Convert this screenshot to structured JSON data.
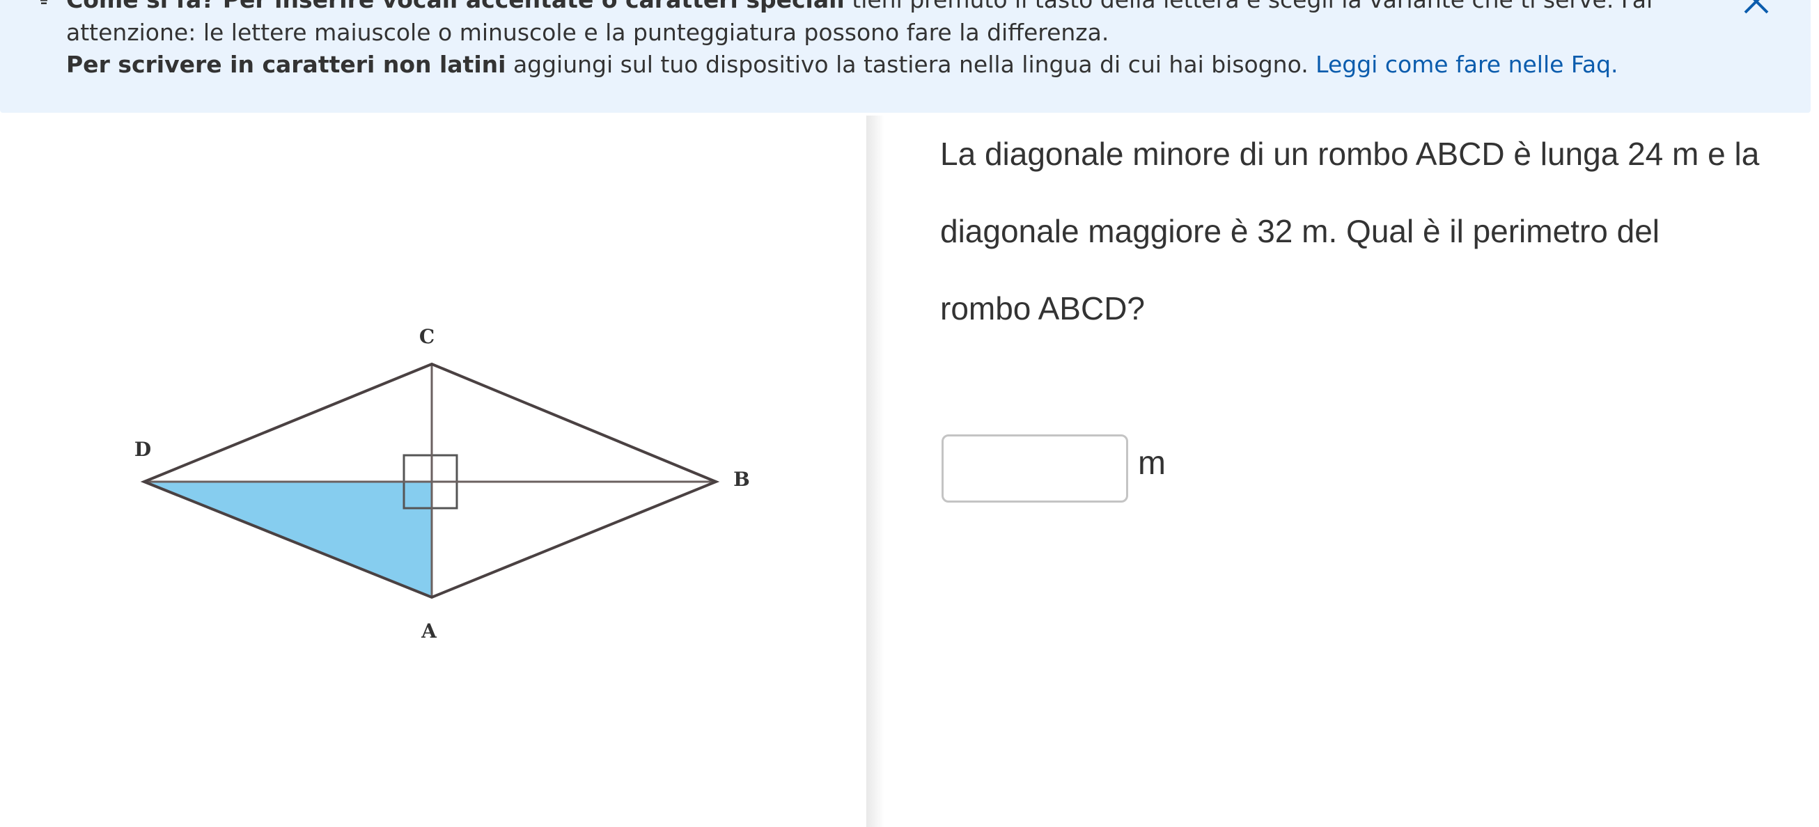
{
  "banner": {
    "line1_bold": "Come si fa? Per inserire vocali accentate o caratteri speciali",
    "line1_rest": " tieni premuto il tasto della lettera e scegli la variante che ti serve. Fai",
    "line2": "attenzione: le lettere maiuscole o minuscole e la punteggiatura possono fare la differenza.",
    "line3_bold": "Per scrivere in caratteri non latini",
    "line3_rest": " aggiungi sul tuo dispositivo la tastiera nella lingua di cui hai bisogno. ",
    "line3_link": "Leggi come fare nelle Faq.",
    "icons": [
      "lightbulb-icon",
      "close-icon"
    ],
    "link_color": "#0b5cad",
    "background_color": "#eaf3fd"
  },
  "figure": {
    "vertex_labels": {
      "a": "A",
      "b": "B",
      "c": "C",
      "d": "D"
    },
    "highlight_color": "#86cdef"
  },
  "question": {
    "line1": "La diagonale minore di un rombo ABCD è lunga 24 m e la",
    "line2": "diagonale maggiore è 32 m. Qual è il perimetro del",
    "line3": "rombo ABCD?"
  },
  "answer": {
    "value": "",
    "unit": "m"
  }
}
